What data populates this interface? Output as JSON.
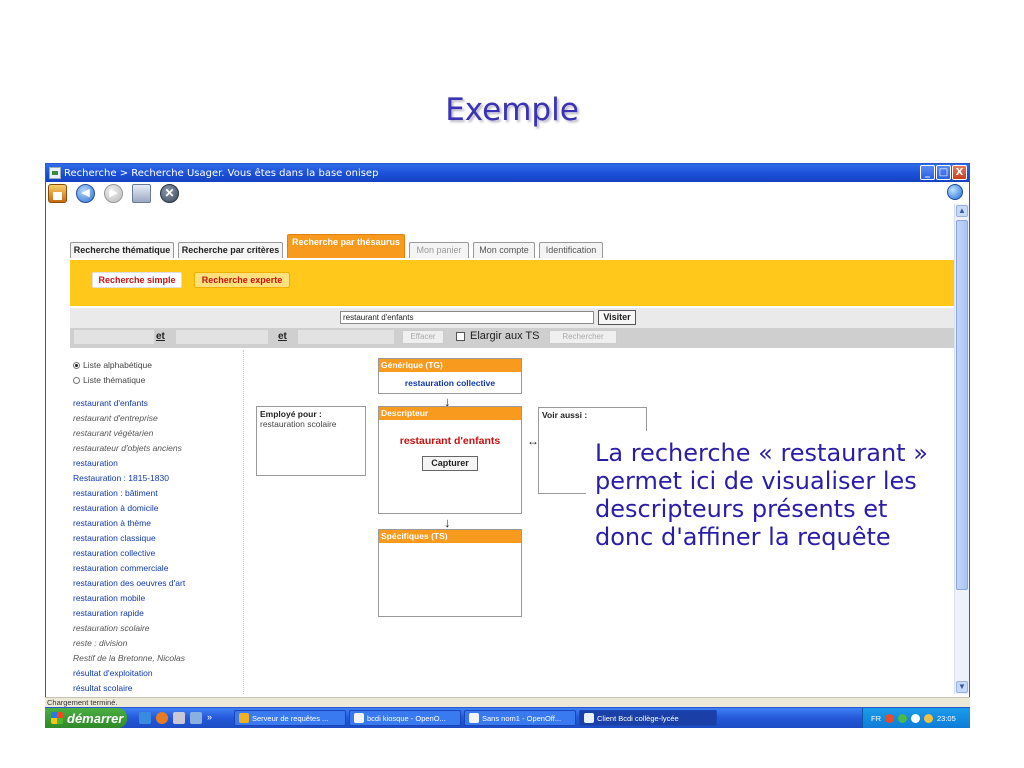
{
  "slide": {
    "title": "Exemple"
  },
  "window": {
    "title": "Recherche > Recherche Usager.  Vous êtes dans la base onisep",
    "controls": [
      "_",
      "□",
      "X"
    ]
  },
  "toolbar": {
    "icons": [
      "home-icon",
      "back-icon",
      "forward-icon",
      "print-icon",
      "stop-icon",
      "globe-icon"
    ]
  },
  "tabs": [
    {
      "label": "Recherche thématique"
    },
    {
      "label": "Recherche par critères"
    },
    {
      "label": "Recherche par thésaurus",
      "active": true
    },
    {
      "label": "Mon panier"
    },
    {
      "label": "Mon compte"
    },
    {
      "label": "Identification"
    }
  ],
  "subtabs": {
    "simple": "Recherche simple",
    "expert": "Recherche experte"
  },
  "search": {
    "value": "restaurant d'enfants",
    "visit_button": "Visiter"
  },
  "operators": {
    "op1": "et",
    "op2": "et",
    "clear_button": "Effacer",
    "broaden_label": "Elargir aux TS",
    "search_button": "Rechercher"
  },
  "list_modes": {
    "alpha": "Liste alphabétique",
    "thematic": "Liste thématique"
  },
  "terms": [
    {
      "label": "restaurant d'enfants",
      "italic": false
    },
    {
      "label": "restaurant d'entreprise",
      "italic": true
    },
    {
      "label": "restaurant végétarien",
      "italic": true
    },
    {
      "label": "restaurateur d'objets anciens",
      "italic": true
    },
    {
      "label": "restauration",
      "italic": false
    },
    {
      "label": "Restauration : 1815-1830",
      "italic": false
    },
    {
      "label": "restauration : bâtiment",
      "italic": false
    },
    {
      "label": "restauration à domicile",
      "italic": false
    },
    {
      "label": "restauration à thème",
      "italic": false
    },
    {
      "label": "restauration classique",
      "italic": false
    },
    {
      "label": "restauration collective",
      "italic": false
    },
    {
      "label": "restauration commerciale",
      "italic": false
    },
    {
      "label": "restauration des oeuvres d'art",
      "italic": false
    },
    {
      "label": "restauration mobile",
      "italic": false
    },
    {
      "label": "restauration rapide",
      "italic": false
    },
    {
      "label": "restauration scolaire",
      "italic": true
    },
    {
      "label": "reste : division",
      "italic": true
    },
    {
      "label": "Restif de la Bretonne, Nicolas",
      "italic": true
    },
    {
      "label": "résultat d'exploitation",
      "italic": false
    },
    {
      "label": "résultat scolaire",
      "italic": false
    }
  ],
  "thesaurus": {
    "used_for_header": "Employé pour :",
    "used_for_value": "restauration scolaire",
    "generic_header": "Générique (TG)",
    "generic_value": "restauration collective",
    "descriptor_header": "Descripteur",
    "descriptor_value": "restaurant d'enfants",
    "capture_button": "Capturer",
    "specific_header": "Spécifiques (TS)",
    "see_also_header": "Voir aussi :",
    "arrow_down": "↓",
    "arrow_both": "↔"
  },
  "callout": {
    "text": "La recherche « restaurant » permet ici de visualiser les descripteurs présents et donc d'affiner la requête"
  },
  "status": {
    "text": "Chargement terminé."
  },
  "taskbar": {
    "start_label": "démarrer",
    "overflow": "»",
    "tasks": [
      {
        "label": "Serveur de requêtes ...",
        "active": false
      },
      {
        "label": "bcdi kiosque - OpenO...",
        "active": false
      },
      {
        "label": "Sans nom1 - OpenOff...",
        "active": false
      },
      {
        "label": "Client Bcdi collège-lycée",
        "active": true
      }
    ],
    "lang": "FR",
    "clock": "23:05"
  },
  "colors": {
    "accent_orange": "#f79a1e",
    "bar_yellow": "#ffc81a",
    "link_blue": "#1238b0",
    "descriptor_red": "#cc1010",
    "callout_text": "#2a1ea8"
  }
}
